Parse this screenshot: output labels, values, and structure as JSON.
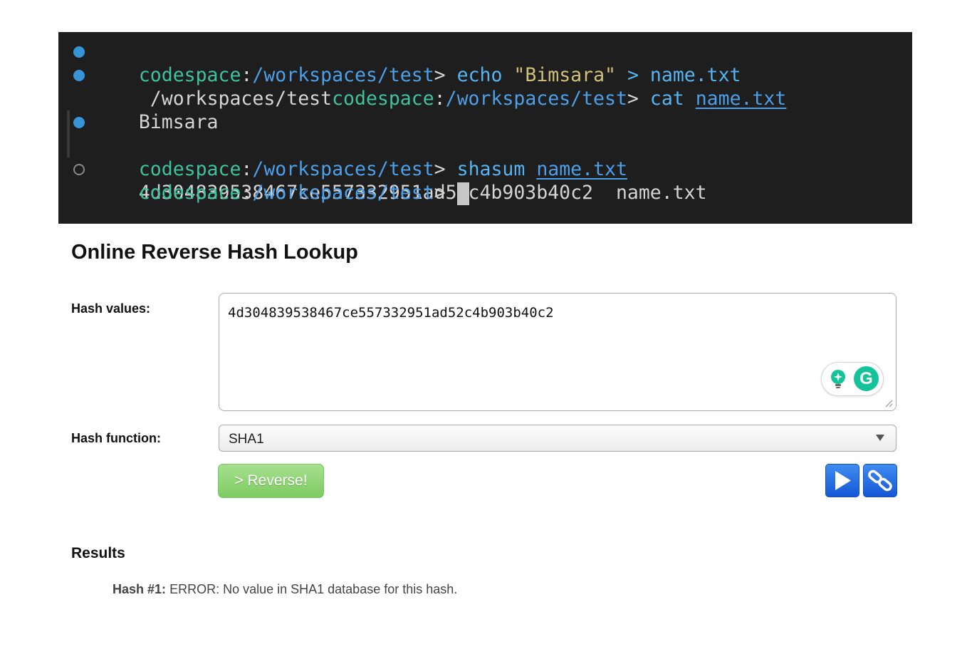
{
  "terminal": {
    "line1": {
      "host": "codespace",
      "colon": ":",
      "path": "/workspaces/test",
      "prompt": ">",
      "cmd": "echo",
      "arg": "\"Bimsara\"",
      "redirect": ">",
      "file": "name.txt"
    },
    "line2": {
      "prefix": "/workspaces/test",
      "host": "codespace",
      "colon": ":",
      "path": "/workspaces/test",
      "prompt": ">",
      "cmd": "cat",
      "file": "name.txt"
    },
    "line3": {
      "output": "Bimsara"
    },
    "line4": {
      "host": "codespace",
      "colon": ":",
      "path": "/workspaces/test",
      "prompt": ">",
      "cmd": "shasum",
      "file": "name.txt"
    },
    "line5": {
      "hash": "4d304839538467ce557332951ad52c4b903b40c2",
      "file": "name.txt"
    },
    "line6": {
      "host": "codespace",
      "colon": ":",
      "path": "/workspaces/test",
      "prompt": ">"
    }
  },
  "page": {
    "title": "Online Reverse Hash Lookup"
  },
  "form": {
    "hash_values_label": "Hash values:",
    "hash_values_value": "4d304839538467ce557332951ad52c4b903b40c2",
    "hash_function_label": "Hash function:",
    "hash_function_value": "SHA1",
    "reverse_button": "> Reverse!",
    "grammarly_letter": "G"
  },
  "results": {
    "title": "Results",
    "item_label": "Hash #1:",
    "item_text": "ERROR: No value in SHA1 database for this hash."
  },
  "colors": {
    "terminal_bg": "#1e1e1e",
    "prompt_host": "#3ec29a",
    "prompt_path": "#4c9fe8",
    "button_green": "#7dcb61",
    "icon_button_blue": "#1557d6",
    "grammarly": "#15c39a"
  },
  "icons": [
    "play-icon",
    "link-icon",
    "lightbulb-icon",
    "grammarly-icon",
    "resize-handle-icon",
    "chevron-down-icon"
  ]
}
